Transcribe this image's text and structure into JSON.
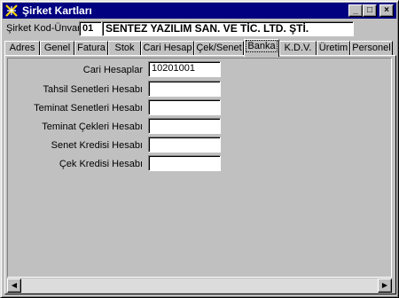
{
  "window": {
    "title": "Şirket Kartları",
    "buttons": {
      "minimize": "_",
      "maximize": "□",
      "close": "×"
    }
  },
  "company": {
    "label": "Şirket Kod-Ünvanı",
    "code": "01",
    "name": "SENTEZ YAZILIM SAN. VE TİC. LTD. ŞTİ."
  },
  "tabs": [
    {
      "label": "Adres"
    },
    {
      "label": "Genel"
    },
    {
      "label": "Fatura"
    },
    {
      "label": "Stok"
    },
    {
      "label": "Cari Hesap"
    },
    {
      "label": "Çek/Senet"
    },
    {
      "label": "Banka"
    },
    {
      "label": "K.D.V."
    },
    {
      "label": "Üretim"
    },
    {
      "label": "Personel"
    }
  ],
  "active_tab": "Banka",
  "bank_form": {
    "rows": [
      {
        "label": "Cari Hesaplar",
        "value": "10201001"
      },
      {
        "label": "Tahsil Senetleri Hesabı",
        "value": ""
      },
      {
        "label": "Teminat Senetleri Hesabı",
        "value": ""
      },
      {
        "label": "Teminat Çekleri Hesabı",
        "value": ""
      },
      {
        "label": "Senet Kredisi Hesabı",
        "value": ""
      },
      {
        "label": "Çek Kredisi Hesabı",
        "value": ""
      }
    ]
  },
  "scrollbar": {
    "left_arrow": "◀",
    "right_arrow": "▶"
  }
}
